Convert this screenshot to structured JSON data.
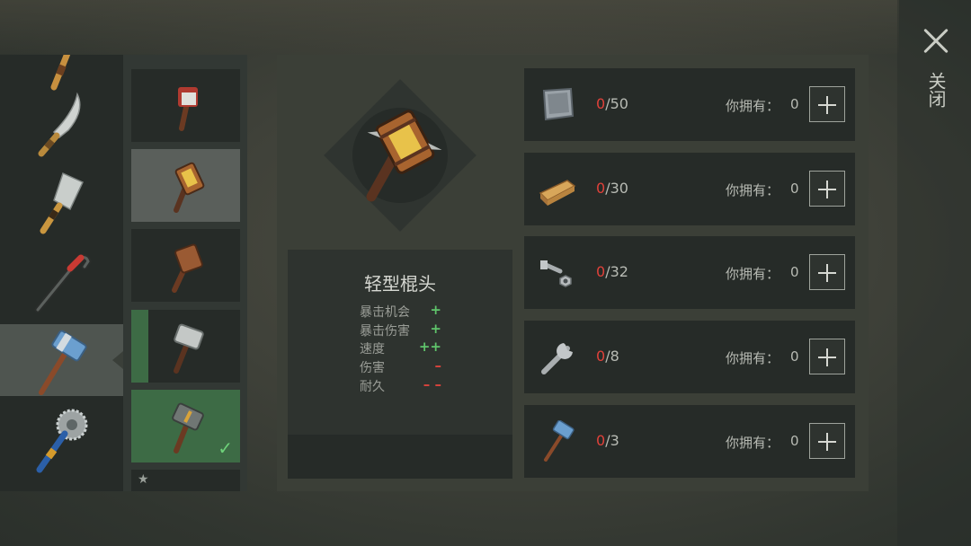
{
  "weapon_list": [
    {
      "name": "bat"
    },
    {
      "name": "machete"
    },
    {
      "name": "cleaver"
    },
    {
      "name": "crowbar"
    },
    {
      "name": "hammer",
      "selected": true
    },
    {
      "name": "saw-mace"
    }
  ],
  "variants": [
    {
      "name": "variant-wrapped-club",
      "state": "normal"
    },
    {
      "name": "variant-light-stick-head",
      "state": "selected"
    },
    {
      "name": "variant-wooden-mallet",
      "state": "normal"
    },
    {
      "name": "variant-steel-hammer",
      "state": "locked"
    },
    {
      "name": "variant-sledgehammer",
      "state": "owned"
    },
    {
      "name": "variant-starred",
      "state": "favorite"
    }
  ],
  "detail": {
    "title": "轻型棍头",
    "stats": [
      {
        "label": "暴击机会",
        "value": "+",
        "tone": "plus"
      },
      {
        "label": "暴击伤害",
        "value": "+",
        "tone": "plus"
      },
      {
        "label": "速度",
        "value": "++",
        "tone": "plus"
      },
      {
        "label": "伤害",
        "value": "–",
        "tone": "minus"
      },
      {
        "label": "耐久",
        "value": "– –",
        "tone": "minus"
      }
    ]
  },
  "materials": [
    {
      "icon": "metal-plate-icon",
      "have": "0",
      "need": "/50",
      "own_label": "你拥有：",
      "own_value": "0"
    },
    {
      "icon": "wood-plank-icon",
      "have": "0",
      "need": "/30",
      "own_label": "你拥有：",
      "own_value": "0"
    },
    {
      "icon": "bolt-nut-icon",
      "have": "0",
      "need": "/32",
      "own_label": "你拥有：",
      "own_value": "0"
    },
    {
      "icon": "wrench-icon",
      "have": "0",
      "need": "/8",
      "own_label": "你拥有：",
      "own_value": "0"
    },
    {
      "icon": "hammer-icon",
      "have": "0",
      "need": "/3",
      "own_label": "你拥有：",
      "own_value": "0"
    }
  ],
  "close_label": "关闭",
  "colors": {
    "accent_green": "#3d6b45",
    "plus": "#5fc46b",
    "minus": "#d8433c",
    "have_red": "#e0413a"
  }
}
